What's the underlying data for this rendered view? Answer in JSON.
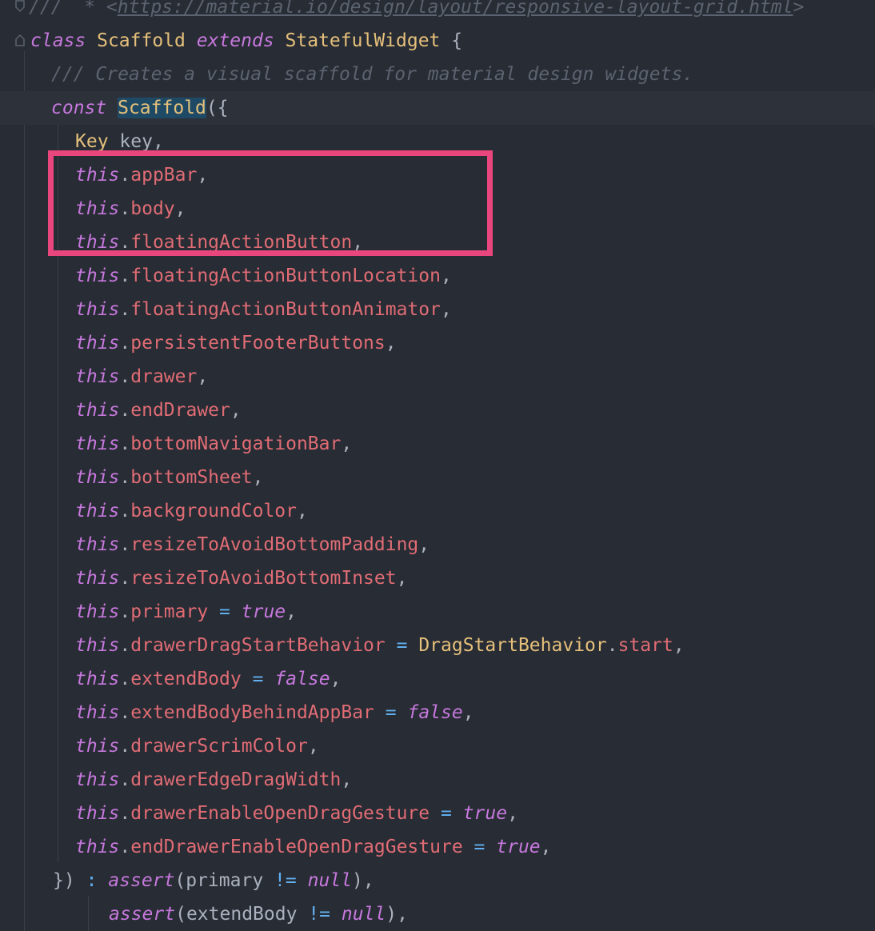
{
  "editor": {
    "colors": {
      "background": "#282c34",
      "current_line": "#2c313a",
      "keyword": "#c678dd",
      "class_name": "#e5c07b",
      "field": "#e06c75",
      "operator": "#61afef",
      "comment": "#5c6370",
      "punctuation": "#abb2bf",
      "highlight_box": "#e8467c"
    },
    "icons": [
      "fold-marker-icon"
    ],
    "lines": [
      {
        "tokens": [
          [
            "cmt",
            "///  * <"
          ],
          [
            "link",
            "https://material.io/design/layout/responsive-layout-grid.html"
          ],
          [
            "cmt",
            ">"
          ]
        ]
      },
      {
        "tokens": [
          [
            "kw",
            "class"
          ],
          [
            "pun",
            " "
          ],
          [
            "cls",
            "Scaffold"
          ],
          [
            "pun",
            " "
          ],
          [
            "kw",
            "extends"
          ],
          [
            "pun",
            " "
          ],
          [
            "cls",
            "StatefulWidget"
          ],
          [
            "pun",
            " {"
          ]
        ]
      },
      {
        "tokens": [
          [
            "cmt",
            "/// Creates a visual scaffold for material design widgets."
          ]
        ]
      },
      {
        "tokens": [
          [
            "kw",
            "const"
          ],
          [
            "pun",
            " "
          ],
          [
            "ctor",
            "Scaffold"
          ],
          [
            "pun",
            "({"
          ]
        ],
        "current": true
      },
      {
        "tokens": [
          [
            "cls",
            "Key"
          ],
          [
            "pun",
            " "
          ],
          [
            "var",
            "key"
          ],
          [
            "pun",
            ","
          ]
        ]
      },
      {
        "tokens": [
          [
            "kw",
            "this"
          ],
          [
            "pun",
            "."
          ],
          [
            "fld",
            "appBar"
          ],
          [
            "pun",
            ","
          ]
        ]
      },
      {
        "tokens": [
          [
            "kw",
            "this"
          ],
          [
            "pun",
            "."
          ],
          [
            "fld",
            "body"
          ],
          [
            "pun",
            ","
          ]
        ]
      },
      {
        "tokens": [
          [
            "kw",
            "this"
          ],
          [
            "pun",
            "."
          ],
          [
            "fld",
            "floatingActionButton"
          ],
          [
            "pun",
            ","
          ]
        ]
      },
      {
        "tokens": [
          [
            "kw",
            "this"
          ],
          [
            "pun",
            "."
          ],
          [
            "fld",
            "floatingActionButtonLocation"
          ],
          [
            "pun",
            ","
          ]
        ]
      },
      {
        "tokens": [
          [
            "kw",
            "this"
          ],
          [
            "pun",
            "."
          ],
          [
            "fld",
            "floatingActionButtonAnimator"
          ],
          [
            "pun",
            ","
          ]
        ]
      },
      {
        "tokens": [
          [
            "kw",
            "this"
          ],
          [
            "pun",
            "."
          ],
          [
            "fld",
            "persistentFooterButtons"
          ],
          [
            "pun",
            ","
          ]
        ]
      },
      {
        "tokens": [
          [
            "kw",
            "this"
          ],
          [
            "pun",
            "."
          ],
          [
            "fld",
            "drawer"
          ],
          [
            "pun",
            ","
          ]
        ]
      },
      {
        "tokens": [
          [
            "kw",
            "this"
          ],
          [
            "pun",
            "."
          ],
          [
            "fld",
            "endDrawer"
          ],
          [
            "pun",
            ","
          ]
        ]
      },
      {
        "tokens": [
          [
            "kw",
            "this"
          ],
          [
            "pun",
            "."
          ],
          [
            "fld",
            "bottomNavigationBar"
          ],
          [
            "pun",
            ","
          ]
        ]
      },
      {
        "tokens": [
          [
            "kw",
            "this"
          ],
          [
            "pun",
            "."
          ],
          [
            "fld",
            "bottomSheet"
          ],
          [
            "pun",
            ","
          ]
        ]
      },
      {
        "tokens": [
          [
            "kw",
            "this"
          ],
          [
            "pun",
            "."
          ],
          [
            "fld",
            "backgroundColor"
          ],
          [
            "pun",
            ","
          ]
        ]
      },
      {
        "tokens": [
          [
            "kw",
            "this"
          ],
          [
            "pun",
            "."
          ],
          [
            "fld",
            "resizeToAvoidBottomPadding"
          ],
          [
            "pun",
            ","
          ]
        ]
      },
      {
        "tokens": [
          [
            "kw",
            "this"
          ],
          [
            "pun",
            "."
          ],
          [
            "fld",
            "resizeToAvoidBottomInset"
          ],
          [
            "pun",
            ","
          ]
        ]
      },
      {
        "tokens": [
          [
            "kw",
            "this"
          ],
          [
            "pun",
            "."
          ],
          [
            "fld",
            "primary"
          ],
          [
            "pun",
            " "
          ],
          [
            "op",
            "="
          ],
          [
            "pun",
            " "
          ],
          [
            "kw",
            "true"
          ],
          [
            "pun",
            ","
          ]
        ]
      },
      {
        "tokens": [
          [
            "kw",
            "this"
          ],
          [
            "pun",
            "."
          ],
          [
            "fld",
            "drawerDragStartBehavior"
          ],
          [
            "pun",
            " "
          ],
          [
            "op",
            "="
          ],
          [
            "pun",
            " "
          ],
          [
            "cls",
            "DragStartBehavior"
          ],
          [
            "pun",
            "."
          ],
          [
            "fld",
            "start"
          ],
          [
            "pun",
            ","
          ]
        ]
      },
      {
        "tokens": [
          [
            "kw",
            "this"
          ],
          [
            "pun",
            "."
          ],
          [
            "fld",
            "extendBody"
          ],
          [
            "pun",
            " "
          ],
          [
            "op",
            "="
          ],
          [
            "pun",
            " "
          ],
          [
            "kw",
            "false"
          ],
          [
            "pun",
            ","
          ]
        ]
      },
      {
        "tokens": [
          [
            "kw",
            "this"
          ],
          [
            "pun",
            "."
          ],
          [
            "fld",
            "extendBodyBehindAppBar"
          ],
          [
            "pun",
            " "
          ],
          [
            "op",
            "="
          ],
          [
            "pun",
            " "
          ],
          [
            "kw",
            "false"
          ],
          [
            "pun",
            ","
          ]
        ]
      },
      {
        "tokens": [
          [
            "kw",
            "this"
          ],
          [
            "pun",
            "."
          ],
          [
            "fld",
            "drawerScrimColor"
          ],
          [
            "pun",
            ","
          ]
        ]
      },
      {
        "tokens": [
          [
            "kw",
            "this"
          ],
          [
            "pun",
            "."
          ],
          [
            "fld",
            "drawerEdgeDragWidth"
          ],
          [
            "pun",
            ","
          ]
        ]
      },
      {
        "tokens": [
          [
            "kw",
            "this"
          ],
          [
            "pun",
            "."
          ],
          [
            "fld",
            "drawerEnableOpenDragGesture"
          ],
          [
            "pun",
            " "
          ],
          [
            "op",
            "="
          ],
          [
            "pun",
            " "
          ],
          [
            "kw",
            "true"
          ],
          [
            "pun",
            ","
          ]
        ]
      },
      {
        "tokens": [
          [
            "kw",
            "this"
          ],
          [
            "pun",
            "."
          ],
          [
            "fld",
            "endDrawerEnableOpenDragGesture"
          ],
          [
            "pun",
            " "
          ],
          [
            "op",
            "="
          ],
          [
            "pun",
            " "
          ],
          [
            "kw",
            "true"
          ],
          [
            "pun",
            ","
          ]
        ]
      },
      {
        "tokens": [
          [
            "pun",
            "})"
          ],
          [
            "pun",
            " "
          ],
          [
            "op",
            ":"
          ],
          [
            "pun",
            " "
          ],
          [
            "kw",
            "assert"
          ],
          [
            "pun",
            "("
          ],
          [
            "var",
            "primary"
          ],
          [
            "pun",
            " "
          ],
          [
            "op",
            "!="
          ],
          [
            "pun",
            " "
          ],
          [
            "kw",
            "null"
          ],
          [
            "pun",
            "),"
          ]
        ]
      },
      {
        "tokens": [
          [
            "kw",
            "assert"
          ],
          [
            "pun",
            "("
          ],
          [
            "var",
            "extendBody"
          ],
          [
            "pun",
            " "
          ],
          [
            "op",
            "!="
          ],
          [
            "pun",
            " "
          ],
          [
            "kw",
            "null"
          ],
          [
            "pun",
            "),"
          ]
        ]
      }
    ]
  }
}
